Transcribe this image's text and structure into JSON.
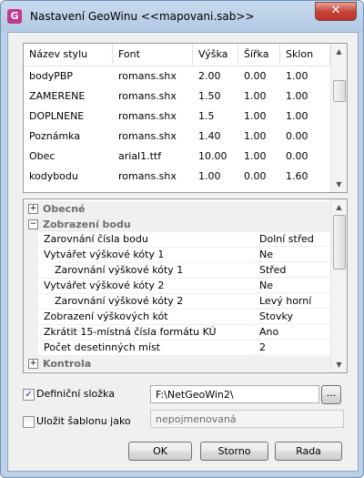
{
  "window": {
    "title": "Nastavení GeoWinu <<mapovani.sab>>",
    "app_icon": "G",
    "close_glyph": "✕"
  },
  "styles_table": {
    "columns": [
      "Název stylu",
      "Font",
      "Výška",
      "Šířka",
      "Sklon"
    ],
    "rows": [
      [
        "bodyPBP",
        "romans.shx",
        "2.00",
        "0.00",
        "1.00"
      ],
      [
        "ZAMERENE",
        "romans.shx",
        "1.50",
        "1.00",
        "1.00"
      ],
      [
        "DOPLNENE",
        "romans.shx",
        "1.5",
        "1.00",
        "1.00"
      ],
      [
        "Poznámka",
        "romans.shx",
        "1.40",
        "1.00",
        "0.00"
      ],
      [
        "Obec",
        "arial1.ttf",
        "10.00",
        "1.00",
        "0.00"
      ],
      [
        "kodybodu",
        "romans.shx",
        "1.00",
        "0.00",
        "1.60"
      ]
    ]
  },
  "property_grid": {
    "categories": [
      {
        "label": "Obecné",
        "toggle": "+"
      },
      {
        "label": "Zobrazení bodu",
        "toggle": "−"
      },
      {
        "label": "Kontrola",
        "toggle": "+"
      }
    ],
    "properties": [
      {
        "name": "Zarovnání čísla bodu",
        "value": "Dolní střed"
      },
      {
        "name": "Vytvářet výškové kóty 1",
        "value": "Ne"
      },
      {
        "name": "Zarovnání výškové kóty 1",
        "value": "Střed"
      },
      {
        "name": "Vytvářet výškové kóty 2",
        "value": "Ne"
      },
      {
        "name": "Zarovnání výškové kóty 2",
        "value": "Levý horní"
      },
      {
        "name": "Zobrazení výškových kót",
        "value": "Stovky"
      },
      {
        "name": "Zkrátit 15-místná čísla formátu KÚ",
        "value": "Ano"
      },
      {
        "name": "Počet desetinných míst",
        "value": "2"
      }
    ]
  },
  "definition_folder": {
    "label": "Definiční složka",
    "checked": true,
    "check_glyph": "✓",
    "value": "F:\\NetGeoWin2\\",
    "browse_label": "..."
  },
  "save_template": {
    "label": "Uložit šablonu jako",
    "checked": false,
    "value": "nepojmenovaná"
  },
  "buttons": {
    "ok": "OK",
    "cancel": "Storno",
    "advice": "Rada"
  },
  "scroll_glyphs": {
    "up": "▲",
    "down": "▼"
  }
}
